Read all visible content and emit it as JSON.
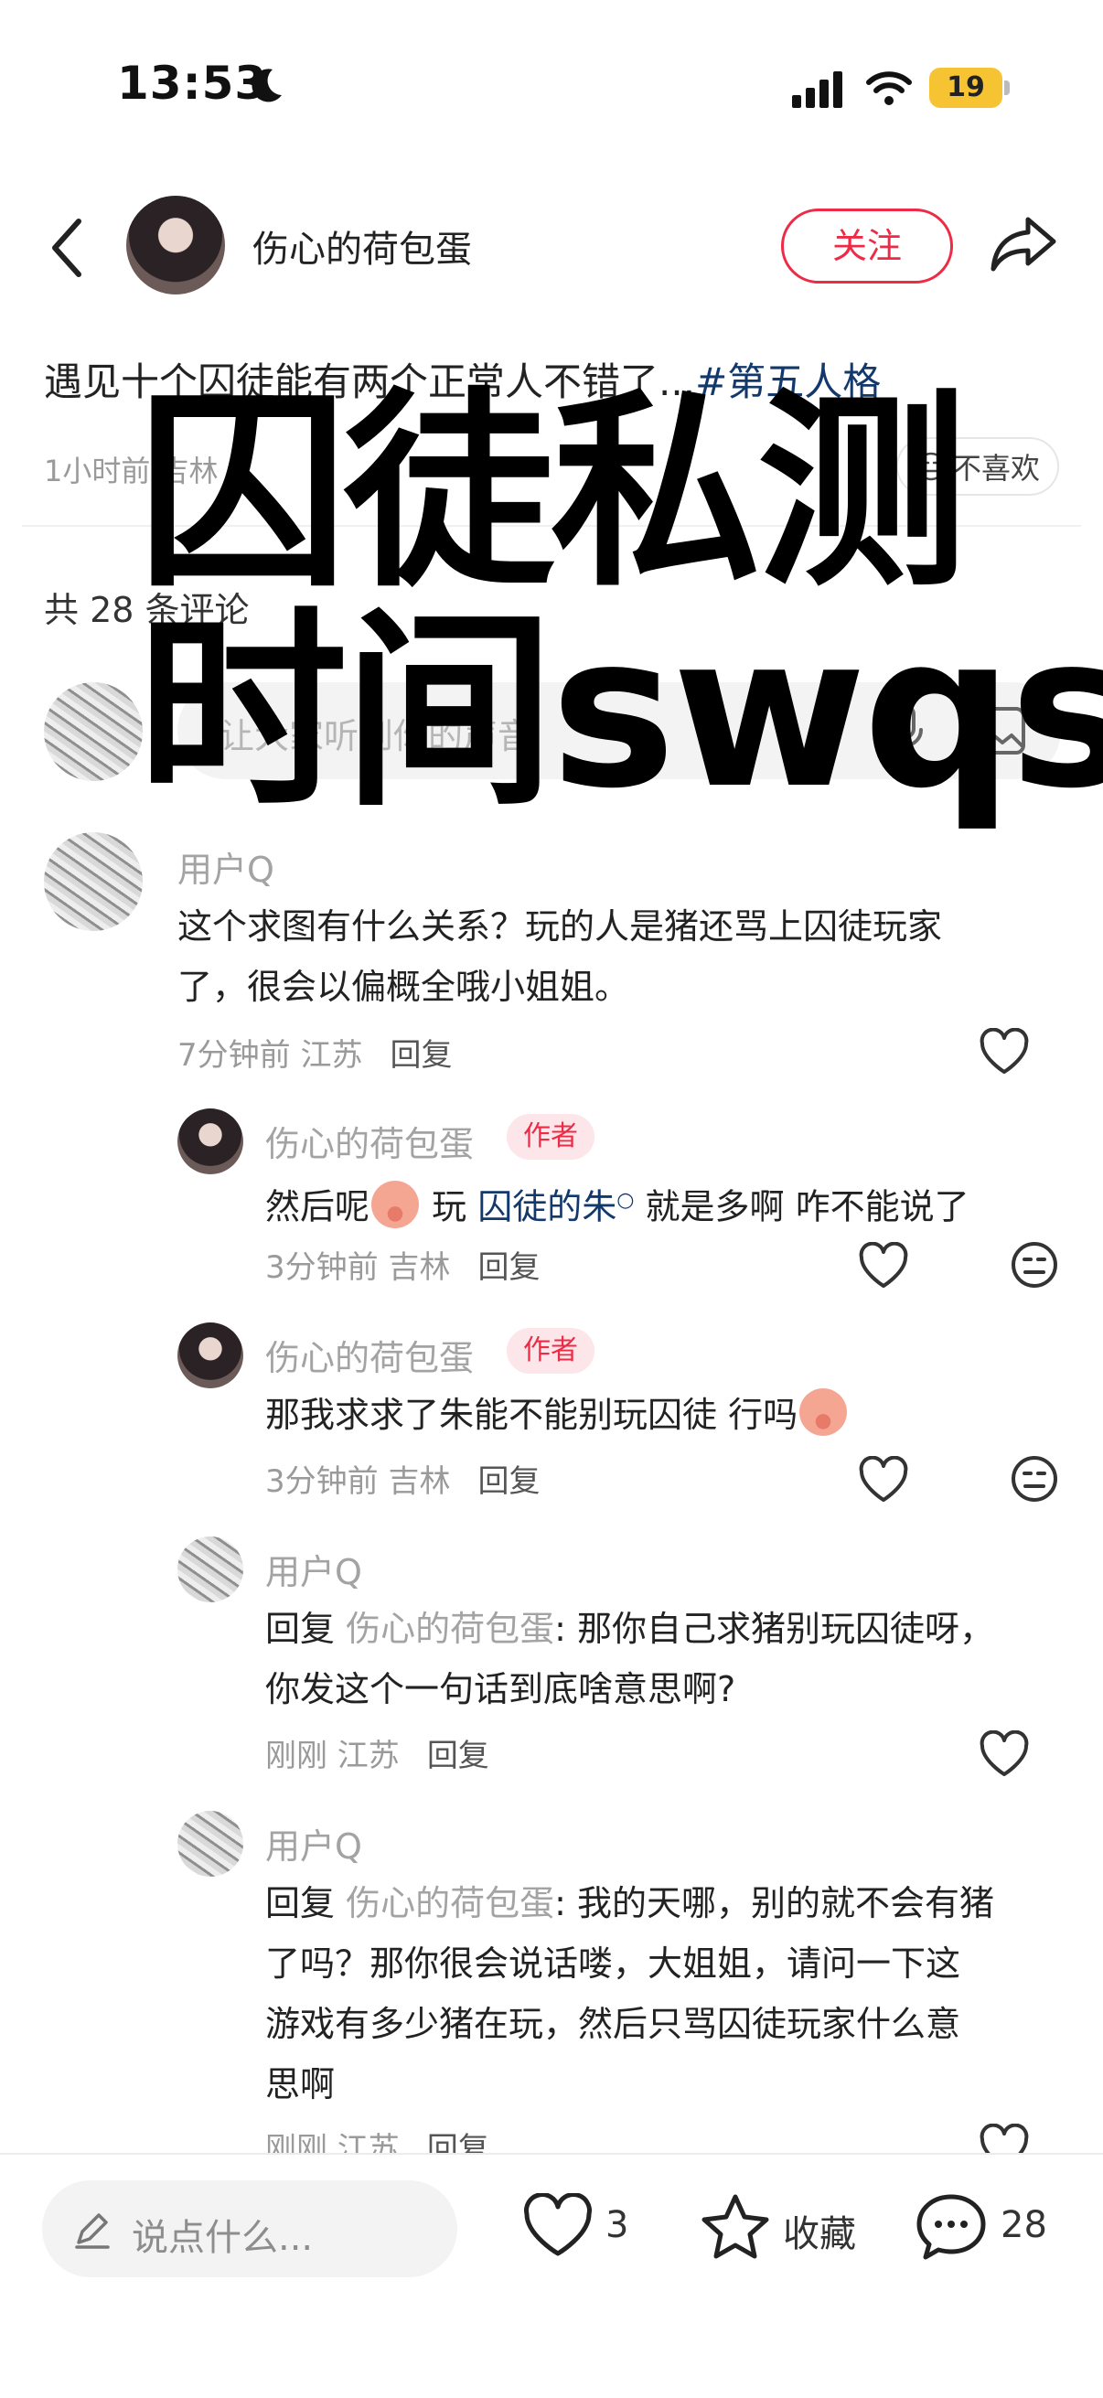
{
  "status_bar": {
    "time": "13:53",
    "battery": "19"
  },
  "header": {
    "author": "伤心的荷包蛋",
    "follow_label": "关注"
  },
  "post": {
    "text": "遇见十个囚徒能有两个正常人不错了...",
    "tag": "#第五人格",
    "meta": "1小时前 吉林",
    "dislike_label": "不喜欢"
  },
  "comments_count_label": "共 28 条评论",
  "comment_input": {
    "placeholder": "让大家听到你的声音"
  },
  "overlay": {
    "line1": "囚徒私测",
    "line2": "时间swqs"
  },
  "comments": [
    {
      "user": "用户Q",
      "text_line1": "这个求图有什么关系？玩的人是猪还骂上囚徒玩家",
      "text_line2": "了，很会以偏概全哦小姐姐。",
      "time": "7分钟前 江苏",
      "reply_label": "回复"
    },
    {
      "user": "伤心的荷包蛋",
      "badge": "作者",
      "text_a": "然后呢",
      "text_b": " 玩 ",
      "link": "囚徒的朱",
      "text_c": " 就是多啊 咋不能说了",
      "time": "3分钟前 吉林",
      "reply_label": "回复"
    },
    {
      "user": "伤心的荷包蛋",
      "badge": "作者",
      "text": "那我求求了朱能不能别玩囚徒 行吗",
      "time": "3分钟前 吉林",
      "reply_label": "回复"
    },
    {
      "user": "用户Q",
      "reply_prefix": "回复 ",
      "mention": "伤心的荷包蛋",
      "text_line1": ": 那你自己求猪别玩囚徒呀，",
      "text_line2": "你发这个一句话到底啥意思啊?",
      "time": "刚刚 江苏",
      "reply_label": "回复"
    },
    {
      "user": "用户Q",
      "reply_prefix": "回复 ",
      "mention": "伤心的荷包蛋",
      "text_line1": ": 我的天哪，别的就不会有猪",
      "text_line2": "了吗？那你很会说话喽，大姐姐，请问一下这",
      "text_line3": "游戏有多少猪在玩，然后只骂囚徒玩家什么意",
      "text_line4": "思啊",
      "time": "刚刚 江苏",
      "reply_label": "回复"
    }
  ],
  "bottom_bar": {
    "say_placeholder": "说点什么...",
    "like_count": "3",
    "favorite_label": "收藏",
    "comment_count": "28"
  },
  "colors": {
    "accent": "#ee2b47",
    "link": "#13386c",
    "muted": "#9a9a9a"
  }
}
